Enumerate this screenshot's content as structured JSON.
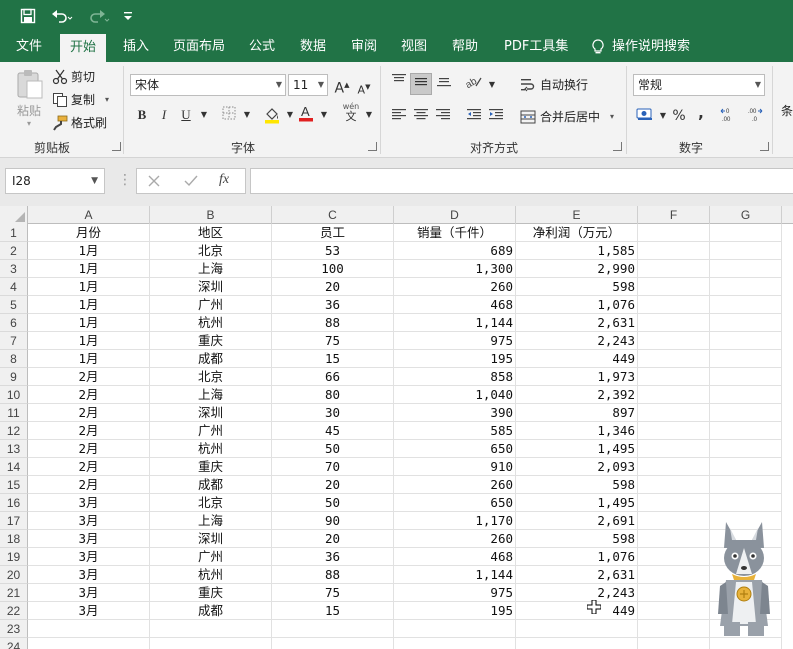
{
  "quick_access": {
    "save_icon": "save-icon",
    "undo_icon": "undo-icon",
    "redo_icon": "redo-icon",
    "customize_icon": "customize-icon"
  },
  "tabs": [
    {
      "label": "文件",
      "active": false
    },
    {
      "label": "开始",
      "active": true
    },
    {
      "label": "插入",
      "active": false
    },
    {
      "label": "页面布局",
      "active": false
    },
    {
      "label": "公式",
      "active": false
    },
    {
      "label": "数据",
      "active": false
    },
    {
      "label": "审阅",
      "active": false
    },
    {
      "label": "视图",
      "active": false
    },
    {
      "label": "帮助",
      "active": false
    },
    {
      "label": "PDF工具集",
      "active": false
    }
  ],
  "tell_me": "操作说明搜索",
  "clipboard": {
    "paste": "粘贴",
    "cut": "剪切",
    "copy": "复制",
    "format_painter": "格式刷",
    "group": "剪贴板"
  },
  "font": {
    "name": "宋体",
    "size": "11",
    "group": "字体",
    "bold": "B",
    "italic": "I",
    "underline": "U",
    "phonetic": "wén"
  },
  "alignment": {
    "wrap": "自动换行",
    "merge": "合并后居中",
    "group": "对齐方式"
  },
  "number": {
    "format": "常规",
    "percent": "%",
    "comma": ",",
    "group": "数字"
  },
  "cut_off_label": "条",
  "name_box": "I28",
  "fx_label": "fx",
  "columns": [
    "A",
    "B",
    "C",
    "D",
    "E",
    "F",
    "G"
  ],
  "headers": [
    "月份",
    "地区",
    "员工",
    "销量（千件）",
    "净利润（万元）"
  ],
  "rows": [
    [
      "1月",
      "北京",
      "53",
      "689",
      "1,585"
    ],
    [
      "1月",
      "上海",
      "100",
      "1,300",
      "2,990"
    ],
    [
      "1月",
      "深圳",
      "20",
      "260",
      "598"
    ],
    [
      "1月",
      "广州",
      "36",
      "468",
      "1,076"
    ],
    [
      "1月",
      "杭州",
      "88",
      "1,144",
      "2,631"
    ],
    [
      "1月",
      "重庆",
      "75",
      "975",
      "2,243"
    ],
    [
      "1月",
      "成都",
      "15",
      "195",
      "449"
    ],
    [
      "2月",
      "北京",
      "66",
      "858",
      "1,973"
    ],
    [
      "2月",
      "上海",
      "80",
      "1,040",
      "2,392"
    ],
    [
      "2月",
      "深圳",
      "30",
      "390",
      "897"
    ],
    [
      "2月",
      "广州",
      "45",
      "585",
      "1,346"
    ],
    [
      "2月",
      "杭州",
      "50",
      "650",
      "1,495"
    ],
    [
      "2月",
      "重庆",
      "70",
      "910",
      "2,093"
    ],
    [
      "2月",
      "成都",
      "20",
      "260",
      "598"
    ],
    [
      "3月",
      "北京",
      "50",
      "650",
      "1,495"
    ],
    [
      "3月",
      "上海",
      "90",
      "1,170",
      "2,691"
    ],
    [
      "3月",
      "深圳",
      "20",
      "260",
      "598"
    ],
    [
      "3月",
      "广州",
      "36",
      "468",
      "1,076"
    ],
    [
      "3月",
      "杭州",
      "88",
      "1,144",
      "2,631"
    ],
    [
      "3月",
      "重庆",
      "75",
      "975",
      "2,243"
    ],
    [
      "3月",
      "成都",
      "15",
      "195",
      "449"
    ]
  ],
  "row_numbers": [
    "1",
    "2",
    "3",
    "4",
    "5",
    "6",
    "7",
    "8",
    "9",
    "10",
    "11",
    "12",
    "13",
    "14",
    "15",
    "16",
    "17",
    "18",
    "19",
    "20",
    "21",
    "22",
    "23",
    "24"
  ],
  "colors": {
    "brand": "#217346",
    "ribbon_bg": "#f3f3f3",
    "grid_line": "#e1e1e1"
  }
}
